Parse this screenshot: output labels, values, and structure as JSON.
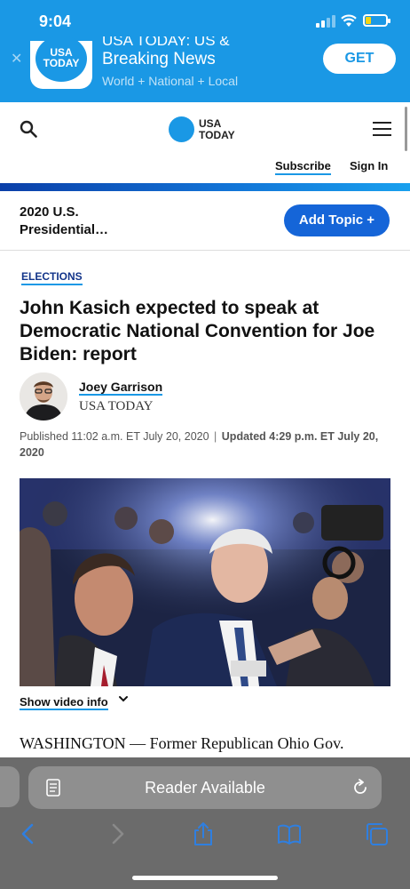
{
  "status_bar": {
    "time": "9:04"
  },
  "banner": {
    "logo_text_line1": "USA",
    "logo_text_line2": "TODAY",
    "title_partial": "USA TODAY: US &",
    "title": "Breaking News",
    "subtitle": "World + National + Local",
    "get_label": "GET"
  },
  "header": {
    "logo_line1": "USA",
    "logo_line2": "TODAY",
    "subscribe_label": "Subscribe",
    "signin_label": "Sign In"
  },
  "topic": {
    "label": "2020 U.S. Presidential…",
    "add_label": "Add Topic +"
  },
  "article": {
    "section": "ELECTIONS",
    "headline": "John Kasich expected to speak at Democratic National Convention for Joe Biden: report",
    "author": "Joey Garrison",
    "org": "USA TODAY",
    "published": "Published 11:02 a.m. ET July 20, 2020",
    "separator": "|",
    "updated": "Updated 4:29 p.m. ET July 20, 2020",
    "show_video": "Show video info",
    "body_start": "WASHINGTON — Former Republican Ohio Gov."
  },
  "safari": {
    "reader_label": "Reader Available"
  },
  "colors": {
    "brand_blue": "#1a98e5",
    "button_blue": "#1565d8",
    "toolbar_gray": "#6b6b6b",
    "icon_blue": "#2f7fe0"
  }
}
